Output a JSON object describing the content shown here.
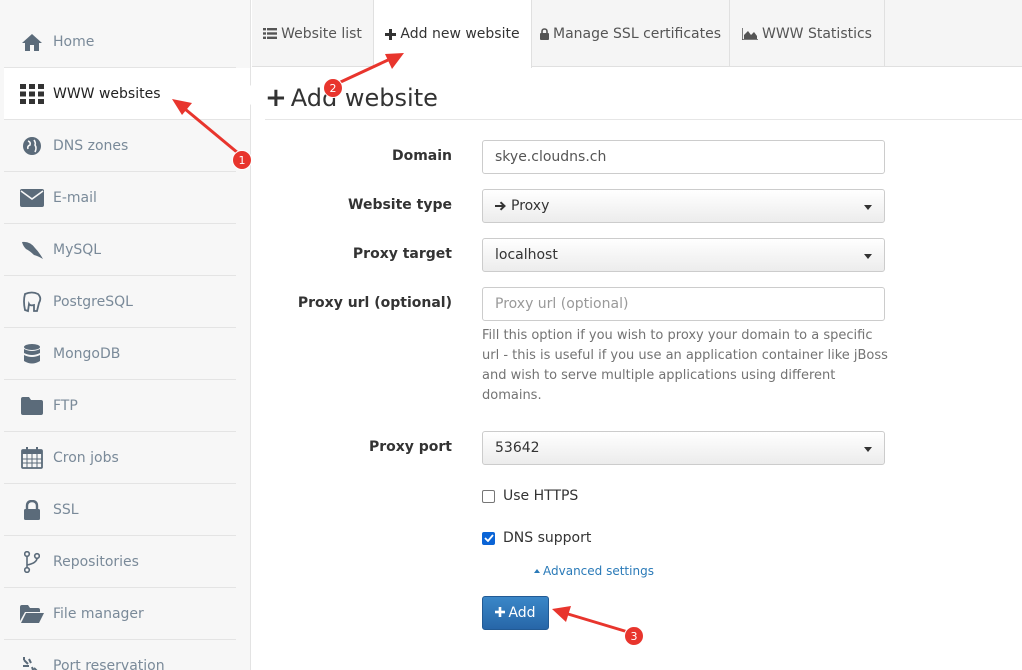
{
  "sidebar": {
    "items": [
      {
        "label": "Home",
        "icon": "home-icon"
      },
      {
        "label": "WWW websites",
        "icon": "grid-icon",
        "active": true
      },
      {
        "label": "DNS zones",
        "icon": "globe-icon"
      },
      {
        "label": "E-mail",
        "icon": "envelope-icon"
      },
      {
        "label": "MySQL",
        "icon": "dolphin-icon"
      },
      {
        "label": "PostgreSQL",
        "icon": "elephant-icon"
      },
      {
        "label": "MongoDB",
        "icon": "database-icon"
      },
      {
        "label": "FTP",
        "icon": "folder-icon"
      },
      {
        "label": "Cron jobs",
        "icon": "calendar-icon"
      },
      {
        "label": "SSL",
        "icon": "lock-icon"
      },
      {
        "label": "Repositories",
        "icon": "branch-icon"
      },
      {
        "label": "File manager",
        "icon": "folder-open-icon"
      },
      {
        "label": "Port reservation",
        "icon": "port-icon"
      }
    ]
  },
  "tabs": [
    {
      "label": "Website list",
      "icon": "list-icon"
    },
    {
      "label": "Add new website",
      "icon": "plus-icon",
      "active": true
    },
    {
      "label": "Manage SSL certificates",
      "icon": "lock-icon"
    },
    {
      "label": "WWW Statistics",
      "icon": "area-chart-icon"
    }
  ],
  "heading": {
    "icon": "+",
    "title": "Add website"
  },
  "form": {
    "domain": {
      "label": "Domain",
      "value": "skye.cloudns.ch"
    },
    "website_type": {
      "label": "Website type",
      "value": "Proxy",
      "icon": "arrow-right-icon"
    },
    "proxy_target": {
      "label": "Proxy target",
      "value": "localhost"
    },
    "proxy_url": {
      "label": "Proxy url (optional)",
      "placeholder": "Proxy url (optional)",
      "value": "",
      "help": "Fill this option if you wish to proxy your domain to a specific url - this is useful if you use an application container like jBoss and wish to serve multiple applications using different domains."
    },
    "proxy_port": {
      "label": "Proxy port",
      "value": "53642"
    },
    "use_https": {
      "label": "Use HTTPS",
      "checked": false
    },
    "dns_support": {
      "label": "DNS support",
      "checked": true
    },
    "advanced_link": "Advanced settings",
    "submit_label": "Add"
  },
  "annotations": [
    {
      "number": "1"
    },
    {
      "number": "2"
    },
    {
      "number": "3"
    }
  ],
  "colors": {
    "accent": "#2766a8",
    "annotation": "#e8352d",
    "checkbox": "#0a64d6",
    "link": "#2a7ab8"
  }
}
